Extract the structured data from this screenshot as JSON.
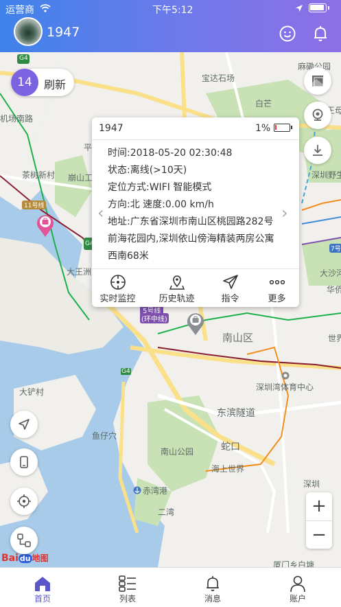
{
  "status_bar": {
    "carrier": "运营商",
    "time": "下午5:12"
  },
  "header": {
    "title": "1947"
  },
  "refresh": {
    "count": "14",
    "label": "刷新"
  },
  "popup": {
    "name": "1947",
    "battery_pct": "1%",
    "lines": [
      "时间:2018-05-20 02:30:48",
      "状态:离线(>10天)",
      "定位方式:WIFI 智能模式",
      "方向:北 速度:0.00 km/h",
      "地址:广东省深圳市南山区桃园路282号",
      "前海花园内,深圳依山傍海精装两房公寓",
      "西南68米"
    ],
    "actions": [
      "实时监控",
      "历史轨迹",
      "指令",
      "更多"
    ]
  },
  "map_labels": [
    "宝达石场",
    "麻磡公园",
    "机场南路",
    "白芒",
    "王母生",
    "平",
    "崩山工",
    "茶树新村",
    "深圳野生",
    "11号线",
    "7号线",
    "大沙河",
    "华侨",
    "大王洲",
    "5号线",
    "(环中线)",
    "南山区",
    "世界",
    "深圳湾体育中心",
    "大铲村",
    "东滨隧道",
    "鱼仔穴",
    "南山公园",
    "蛇口",
    "海上世界",
    "赤湾港",
    "二湾",
    "深圳",
    "厦门乡白塘",
    "G4",
    "G4",
    "G4"
  ],
  "map_brand": {
    "bai": "Bai",
    "du": "du",
    "tail": "地图"
  },
  "zoom": {
    "plus": "+",
    "minus": "−"
  },
  "tabs": [
    "首页",
    "列表",
    "消息",
    "账户"
  ],
  "colors": {
    "accent": "#5a55c8",
    "header_start": "#3f83ea",
    "header_end": "#8e6fe6",
    "pin": "#e0559a"
  }
}
